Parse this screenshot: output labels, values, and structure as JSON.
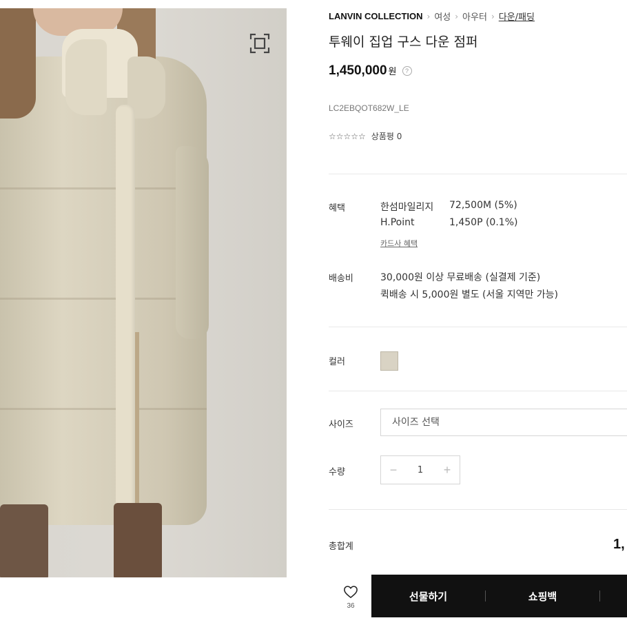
{
  "breadcrumb": {
    "brand": "LANVIN COLLECTION",
    "items": [
      "여성",
      "아우터",
      "다운/패딩"
    ]
  },
  "product": {
    "title": "투웨이 집업 구스 다운 점퍼",
    "price": "1,450,000",
    "price_unit": "원",
    "code": "LC2EBQOT682W_LE",
    "stars": "☆☆☆☆☆",
    "review_label": "상품평 0"
  },
  "benefits": {
    "label": "혜택",
    "rows": [
      {
        "name": "한섬마일리지",
        "value": "72,500M (5%)"
      },
      {
        "name": "H.Point",
        "value": "1,450P (0.1%)"
      }
    ],
    "card_link": "카드사 혜택"
  },
  "shipping": {
    "label": "배송비",
    "lines": [
      "30,000원 이상 무료배송 (실결제 기준)",
      "퀵배송 시 5,000원 별도 (서울 지역만 가능)"
    ]
  },
  "color": {
    "label": "컬러",
    "swatch_color": "#d9d3c4"
  },
  "size": {
    "label": "사이즈",
    "placeholder": "사이즈 선택"
  },
  "quantity": {
    "label": "수량",
    "value": "1",
    "minus": "−",
    "plus": "+"
  },
  "total": {
    "label": "총합계",
    "value": "1,"
  },
  "actions": {
    "wish_count": "36",
    "gift": "선물하기",
    "cart": "쇼핑백"
  },
  "colors": {
    "cta_background": "#111111",
    "accent_text": "#111111"
  }
}
